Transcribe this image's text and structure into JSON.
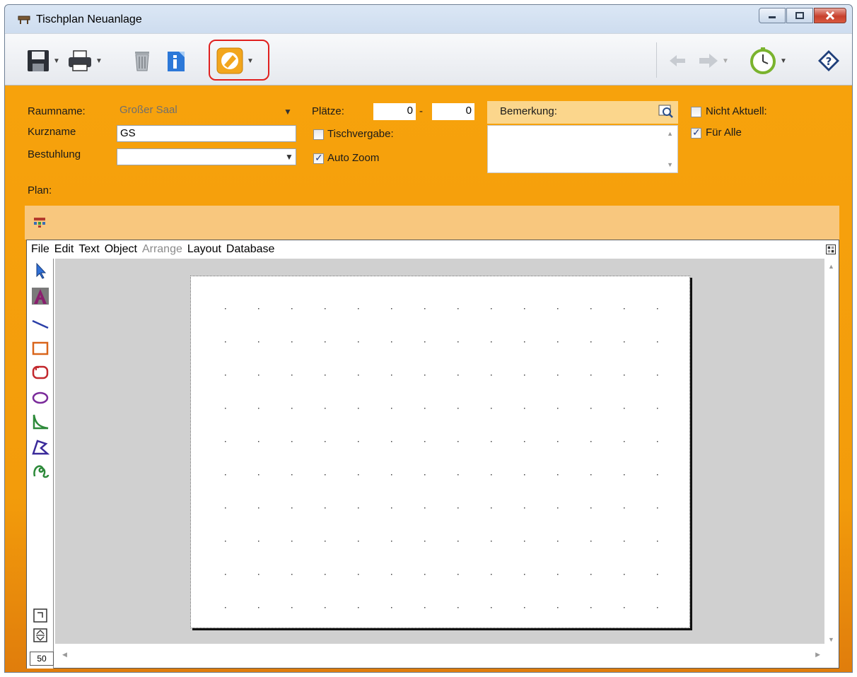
{
  "window": {
    "title": "Tischplan Neuanlage"
  },
  "form": {
    "raumname_label": "Raumname:",
    "raumname_value": "Großer Saal",
    "kurzname_label": "Kurzname",
    "kurzname_value": "GS",
    "bestuhlung_label": "Bestuhlung",
    "bestuhlung_value": "",
    "plaetze_label": "Plätze:",
    "plaetze_from": "0",
    "plaetze_sep": "-",
    "plaetze_to": "0",
    "tischvergabe_label": "Tischvergabe:",
    "tischvergabe_checked": false,
    "autozoom_label": "Auto Zoom",
    "autozoom_checked": true,
    "bemerkung_label": "Bemerkung:",
    "bemerkung_value": "",
    "nicht_aktuell_label": "Nicht Aktuell:",
    "nicht_aktuell_checked": false,
    "fuer_alle_label": "Für Alle",
    "fuer_alle_checked": true,
    "plan_label": "Plan:"
  },
  "designer": {
    "menus": [
      "File",
      "Edit",
      "Text",
      "Object",
      "Arrange",
      "Layout",
      "Database"
    ],
    "disabled_menus": [
      "Arrange"
    ],
    "zoom": "50",
    "tools": [
      "pointer-icon",
      "text-tool-icon",
      "line-tool-icon",
      "rectangle-tool-icon",
      "rounded-rectangle-tool-icon",
      "ellipse-tool-icon",
      "arc-tool-icon",
      "polygon-tool-icon",
      "freehand-tool-icon"
    ]
  },
  "colors": {
    "panel_orange": "#f39c0b",
    "highlight_red": "#e0201f"
  }
}
